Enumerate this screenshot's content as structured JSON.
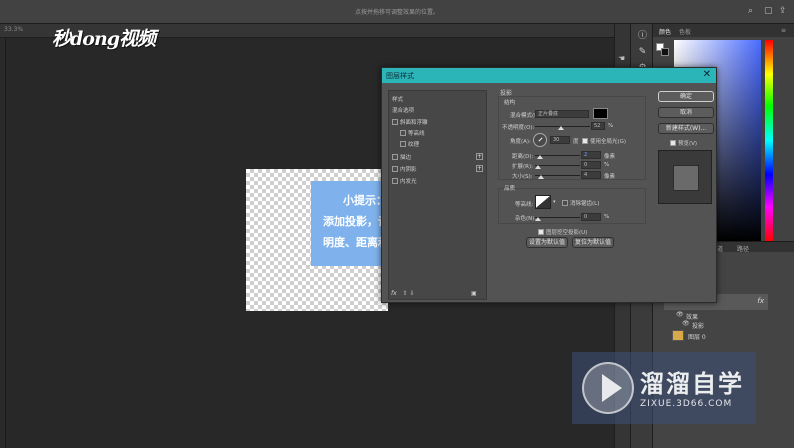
{
  "app": {
    "title": "点按并拖移可调整效果的位置。",
    "doc_info": "33.3%",
    "logo": "秒dong视频"
  },
  "tooltip": {
    "heading": "小提示：",
    "line1": "添加投影，调整不透",
    "line2": "明度、距离和大小"
  },
  "right_panel": {
    "tab_color": "颜色",
    "tab_swatches": "色板",
    "layers_tabs": [
      "图层",
      "通道",
      "路径"
    ],
    "layers": [
      {
        "name": "效果"
      },
      {
        "name": "投影"
      },
      {
        "name": "图层 0"
      }
    ],
    "fx_label": "fx"
  },
  "dialog": {
    "title": "图层样式",
    "close": "✕",
    "styles_header": "样式",
    "blend_options": "混合选项",
    "effects": [
      {
        "label": "斜面和浮雕",
        "checked": false,
        "plus": false
      },
      {
        "label": "等高线",
        "checked": false,
        "plus": false
      },
      {
        "label": "纹理",
        "checked": false,
        "plus": false
      },
      {
        "label": "描边",
        "checked": false,
        "plus": true
      },
      {
        "label": "内阴影",
        "checked": false,
        "plus": true
      },
      {
        "label": "内发光",
        "checked": false,
        "plus": false
      }
    ],
    "footer_fx": "fx",
    "footer_arrows": "⇧ ⇩",
    "footer_trash": "🗑",
    "section_title": "投影",
    "structure": "结构",
    "blend_mode_label": "混合模式(B):",
    "blend_mode_value": "正片叠底",
    "opacity_label": "不透明度(O):",
    "opacity_value": "52",
    "angle_label": "角度(A):",
    "angle_value": "30",
    "global_light": "使用全局光(G)",
    "distance_label": "距离(D):",
    "distance_value": "2",
    "spread_label": "扩展(R):",
    "spread_value": "0",
    "size_label": "大小(S):",
    "size_value": "4",
    "unit_percent": "%",
    "unit_px": "像素",
    "unit_deg": "度",
    "quality": "品质",
    "contour_label": "等高线:",
    "anti_alias": "消除锯齿(L)",
    "noise_label": "杂色(N):",
    "noise_value": "0",
    "knockout": "图层挖空投影(U)",
    "set_default": "设置为默认值",
    "reset_default": "复位为默认值",
    "btn_ok": "确定",
    "btn_cancel": "取消",
    "btn_new_style": "新建样式(W)...",
    "preview_label": "预览(V)"
  },
  "watermark": {
    "brand": "溜溜自学",
    "url": "ZIXUE.3D66.COM"
  }
}
